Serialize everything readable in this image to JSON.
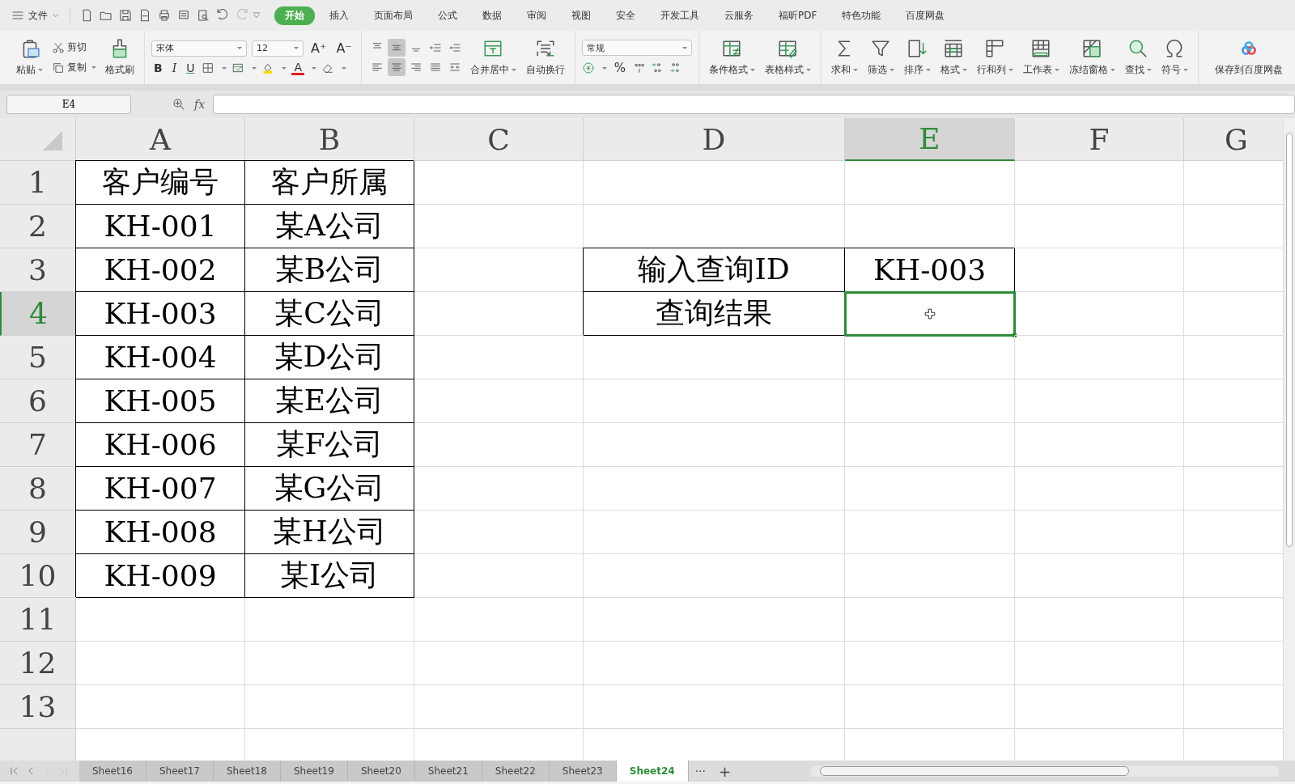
{
  "menu_bar": {
    "file_menu": "文件",
    "quick_access": [
      {
        "disabled": false
      },
      {
        "disabled": false
      },
      {
        "disabled": false
      },
      {
        "disabled": false
      },
      {
        "disabled": false
      },
      {
        "disabled": false
      },
      {
        "disabled": false
      },
      {
        "disabled": false
      },
      {
        "disabled": true
      }
    ],
    "tabs": [
      {
        "label": "开始",
        "selected": true
      },
      {
        "label": "插入",
        "selected": false
      },
      {
        "label": "页面布局",
        "selected": false
      },
      {
        "label": "公式",
        "selected": false
      },
      {
        "label": "数据",
        "selected": false
      },
      {
        "label": "审阅",
        "selected": false
      },
      {
        "label": "视图",
        "selected": false
      },
      {
        "label": "安全",
        "selected": false
      },
      {
        "label": "开发工具",
        "selected": false
      },
      {
        "label": "云服务",
        "selected": false
      },
      {
        "label": "福昕PDF",
        "selected": false
      },
      {
        "label": "特色功能",
        "selected": false
      },
      {
        "label": "百度网盘",
        "selected": false
      }
    ]
  },
  "ribbon": {
    "clipboard": [
      {
        "label": "粘贴",
        "kind": "large",
        "dropdown": true
      },
      {
        "label": "剪切",
        "kind": "small",
        "dropdown": false
      },
      {
        "label": "复制",
        "kind": "small",
        "dropdown": true
      },
      {
        "label": "格式刷",
        "kind": "large",
        "dropdown": false
      }
    ],
    "font": {
      "name": "宋体",
      "size": "12",
      "grow": "A⁺",
      "shrink": "A⁻",
      "bold": "B",
      "italic": "I",
      "underline": "U",
      "font_color": "A"
    },
    "alignment": [
      {
        "selected": false
      },
      {
        "selected": true
      },
      {
        "selected": false
      },
      {
        "selected": false
      },
      {
        "selected": false
      },
      {
        "selected": false
      },
      {
        "selected": true
      },
      {
        "selected": false
      },
      {
        "selected": false
      },
      {
        "selected": false
      }
    ],
    "merge": [
      {
        "label": "合并居中",
        "dropdown": true
      },
      {
        "label": "自动换行",
        "dropdown": false
      }
    ],
    "number_format": "常规",
    "percent": "%",
    "styles": [
      {
        "label": "条件格式",
        "dropdown": true
      },
      {
        "label": "表格样式",
        "dropdown": true
      }
    ],
    "tools": [
      {
        "label": "求和",
        "dropdown": true
      },
      {
        "label": "筛选",
        "dropdown": true
      },
      {
        "label": "排序",
        "dropdown": true
      },
      {
        "label": "格式",
        "dropdown": true
      },
      {
        "label": "行和列",
        "dropdown": true
      },
      {
        "label": "工作表",
        "dropdown": true
      },
      {
        "label": "冻结窗格",
        "dropdown": true
      },
      {
        "label": "查找",
        "dropdown": true
      },
      {
        "label": "符号",
        "dropdown": true
      }
    ],
    "cloud_save": "保存到百度网盘"
  },
  "name_box": "E4",
  "formula_label": "fx",
  "sheet": {
    "columns": [
      {
        "label": "A",
        "selected": false
      },
      {
        "label": "B",
        "selected": false
      },
      {
        "label": "C",
        "selected": false
      },
      {
        "label": "D",
        "selected": false
      },
      {
        "label": "E",
        "selected": true
      },
      {
        "label": "F",
        "selected": false
      },
      {
        "label": "G",
        "selected": false
      }
    ],
    "rows": [
      {
        "label": "1",
        "selected": false,
        "cells": [
          {
            "text": "客户编号",
            "bordered": true
          },
          {
            "text": "客户所属",
            "bordered": true
          },
          null,
          null,
          null,
          null,
          null
        ]
      },
      {
        "label": "2",
        "selected": false,
        "cells": [
          {
            "text": "KH-001",
            "bordered": true
          },
          {
            "text": "某A公司",
            "bordered": true
          },
          null,
          null,
          null,
          null,
          null
        ]
      },
      {
        "label": "3",
        "selected": false,
        "cells": [
          {
            "text": "KH-002",
            "bordered": true
          },
          {
            "text": "某B公司",
            "bordered": true
          },
          null,
          {
            "text": "输入查询ID",
            "bordered": true
          },
          {
            "text": "KH-003",
            "bordered": true
          },
          null,
          null
        ]
      },
      {
        "label": "4",
        "selected": true,
        "cells": [
          {
            "text": "KH-003",
            "bordered": true
          },
          {
            "text": "某C公司",
            "bordered": true
          },
          null,
          {
            "text": "查询结果",
            "bordered": true
          },
          {
            "bordered": true,
            "selected": true
          },
          null,
          null
        ]
      },
      {
        "label": "5",
        "selected": false,
        "cells": [
          {
            "text": "KH-004",
            "bordered": true
          },
          {
            "text": "某D公司",
            "bordered": true
          },
          null,
          null,
          null,
          null,
          null
        ]
      },
      {
        "label": "6",
        "selected": false,
        "cells": [
          {
            "text": "KH-005",
            "bordered": true
          },
          {
            "text": "某E公司",
            "bordered": true
          },
          null,
          null,
          null,
          null,
          null
        ]
      },
      {
        "label": "7",
        "selected": false,
        "cells": [
          {
            "text": "KH-006",
            "bordered": true
          },
          {
            "text": "某F公司",
            "bordered": true
          },
          null,
          null,
          null,
          null,
          null
        ]
      },
      {
        "label": "8",
        "selected": false,
        "cells": [
          {
            "text": "KH-007",
            "bordered": true
          },
          {
            "text": "某G公司",
            "bordered": true
          },
          null,
          null,
          null,
          null,
          null
        ]
      },
      {
        "label": "9",
        "selected": false,
        "cells": [
          {
            "text": "KH-008",
            "bordered": true
          },
          {
            "text": "某H公司",
            "bordered": true
          },
          null,
          null,
          null,
          null,
          null
        ]
      },
      {
        "label": "10",
        "selected": false,
        "cells": [
          {
            "text": "KH-009",
            "bordered": true
          },
          {
            "text": "某I公司",
            "bordered": true
          },
          null,
          null,
          null,
          null,
          null
        ]
      },
      {
        "label": "11",
        "selected": false,
        "cells": [
          null,
          null,
          null,
          null,
          null,
          null,
          null
        ]
      },
      {
        "label": "12",
        "selected": false,
        "cells": [
          null,
          null,
          null,
          null,
          null,
          null,
          null
        ]
      },
      {
        "label": "13",
        "selected": false,
        "cells": [
          null,
          null,
          null,
          null,
          null,
          null,
          null
        ]
      }
    ]
  },
  "sheet_tabs": [
    {
      "label": "Sheet16",
      "selected": false
    },
    {
      "label": "Sheet17",
      "selected": false
    },
    {
      "label": "Sheet18",
      "selected": false
    },
    {
      "label": "Sheet19",
      "selected": false
    },
    {
      "label": "Sheet20",
      "selected": false
    },
    {
      "label": "Sheet21",
      "selected": false
    },
    {
      "label": "Sheet22",
      "selected": false
    },
    {
      "label": "Sheet23",
      "selected": false
    },
    {
      "label": "Sheet24",
      "selected": true
    }
  ],
  "more_sheets": "···",
  "add_sheet": "+"
}
